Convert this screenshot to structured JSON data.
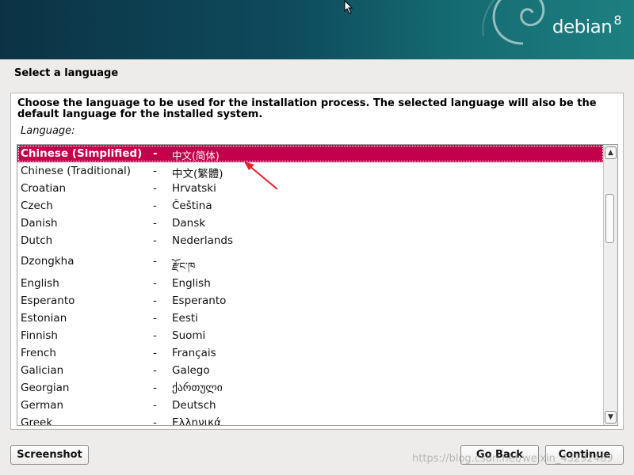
{
  "header": {
    "logo_text": "debian",
    "logo_version": "8"
  },
  "page": {
    "title": "Select a language",
    "description": "Choose the language to be used for the installation process. The selected language will also be the default language for the installed system.",
    "list_label": "Language:"
  },
  "languages": [
    {
      "english": "Chinese (Simplified)",
      "separator": "-",
      "native": "中文(简体)",
      "selected": true
    },
    {
      "english": "Chinese (Traditional)",
      "separator": "-",
      "native": "中文(繁體)"
    },
    {
      "english": "Croatian",
      "separator": "-",
      "native": "Hrvatski"
    },
    {
      "english": "Czech",
      "separator": "-",
      "native": "Čeština"
    },
    {
      "english": "Danish",
      "separator": "-",
      "native": "Dansk"
    },
    {
      "english": "Dutch",
      "separator": "-",
      "native": "Nederlands"
    },
    {
      "english": "Dzongkha",
      "separator": "-",
      "native": "རྫོང་ཁ"
    },
    {
      "english": "English",
      "separator": "-",
      "native": "English"
    },
    {
      "english": "Esperanto",
      "separator": "-",
      "native": "Esperanto"
    },
    {
      "english": "Estonian",
      "separator": "-",
      "native": "Eesti"
    },
    {
      "english": "Finnish",
      "separator": "-",
      "native": "Suomi"
    },
    {
      "english": "French",
      "separator": "-",
      "native": "Français"
    },
    {
      "english": "Galician",
      "separator": "-",
      "native": "Galego"
    },
    {
      "english": "Georgian",
      "separator": "-",
      "native": "ქართული"
    },
    {
      "english": "German",
      "separator": "-",
      "native": "Deutsch"
    },
    {
      "english": "Greek",
      "separator": "-",
      "native": "Ελληνικά"
    }
  ],
  "buttons": {
    "screenshot": "Screenshot",
    "go_back": "Go Back",
    "continue": "Continue"
  },
  "watermark": "https://blog.csdn.net/weixin_43292469",
  "colors": {
    "selection": "#c3004a",
    "annotation_arrow": "#e8202a",
    "banner": "#0e4a5c"
  },
  "icons": {
    "cursor": "mouse-pointer-icon",
    "scroll_up": "chevron-up-icon",
    "scroll_down": "chevron-down-icon",
    "annotation": "red-arrow-icon"
  }
}
